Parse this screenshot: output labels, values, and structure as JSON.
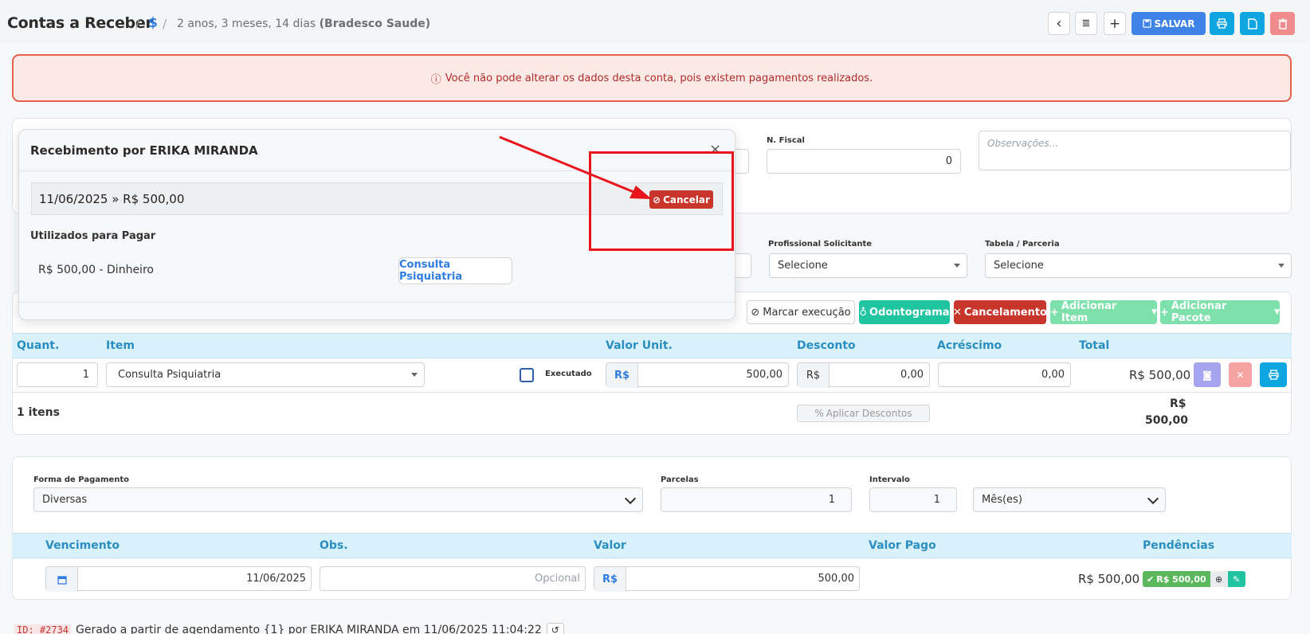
{
  "header": {
    "title": "Contas a Receber",
    "separator": "/",
    "crumb_icon": "$",
    "crumb_desc": "2 anos, 3 meses, 14 dias",
    "crumb_desc_bold": "(Bradesco Saude)",
    "buttons": {
      "back": "‹",
      "list": "≣",
      "add": "+",
      "save": "SALVAR"
    }
  },
  "alert": {
    "icon": "ⓘ",
    "text": "Você não pode alterar os dados desta conta, pois existem pagamentos realizados."
  },
  "general": {
    "nfiscal_label": "N. Fiscal",
    "nfiscal_value": "0",
    "obs_placeholder": "Observações...",
    "prof_label": "Profissional Solicitante",
    "prof_value": "Selecione",
    "tabela_label": "Tabela / Parceria",
    "tabela_value": "Selecione"
  },
  "actions": {
    "marcar": "Marcar execução",
    "odontograma": "Odontograma",
    "cancelamento": "Cancelamento",
    "add_item": "Adicionar Item",
    "add_pacote": "Adicionar Pacote"
  },
  "items_table": {
    "headers": {
      "quant": "Quant.",
      "item": "Item",
      "valor_unit": "Valor Unit.",
      "desconto": "Desconto",
      "acrescimo": "Acréscimo",
      "total": "Total"
    },
    "row": {
      "quant": "1",
      "item": "Consulta Psiquiatria",
      "executado": "Executado",
      "currency": "R$",
      "valor_unit": "500,00",
      "desconto": "0,00",
      "acrescimo": "0,00",
      "total": "R$ 500,00"
    },
    "footer": {
      "count": "1 itens",
      "apply_discount": "Aplicar Descontos",
      "total_line1": "R$",
      "total_line2": "500,00"
    }
  },
  "payment": {
    "forma_label": "Forma de Pagamento",
    "forma_value": "Diversas",
    "parcelas_label": "Parcelas",
    "parcelas_value": "1",
    "intervalo_label": "Intervalo",
    "intervalo_value": "1",
    "unidade_value": "Mês(es)",
    "headers": {
      "vencimento": "Vencimento",
      "obs": "Obs.",
      "valor": "Valor",
      "valor_pago": "Valor Pago",
      "pendencias": "Pendências"
    },
    "row": {
      "vencimento": "11/06/2025",
      "obs_placeholder": "Opcional",
      "currency": "R$",
      "valor": "500,00",
      "valor_pago": "R$ 500,00",
      "badge": "R$ 500,00"
    }
  },
  "modal": {
    "title": "Recebimento por ERIKA MIRANDA",
    "close": "×",
    "payment_line": "11/06/2025 » R$ 500,00",
    "cancel_label": "Cancelar",
    "used_label": "Utilizados para Pagar",
    "used_value": "R$ 500,00 - Dinheiro",
    "used_item": "Consulta Psiquiatria"
  },
  "footer": {
    "id": "ID: #2734",
    "text": "Gerado a partir de agendamento {1} por ERIKA MIRANDA em 11/06/2025 11:04:22"
  },
  "colors": {
    "primary": "#3f83e6",
    "cyan": "#0ea5e0",
    "danger": "#c7352b",
    "teal": "#20c4a0",
    "success_light": "#7ee0ab",
    "annotation": "#e8131b"
  }
}
